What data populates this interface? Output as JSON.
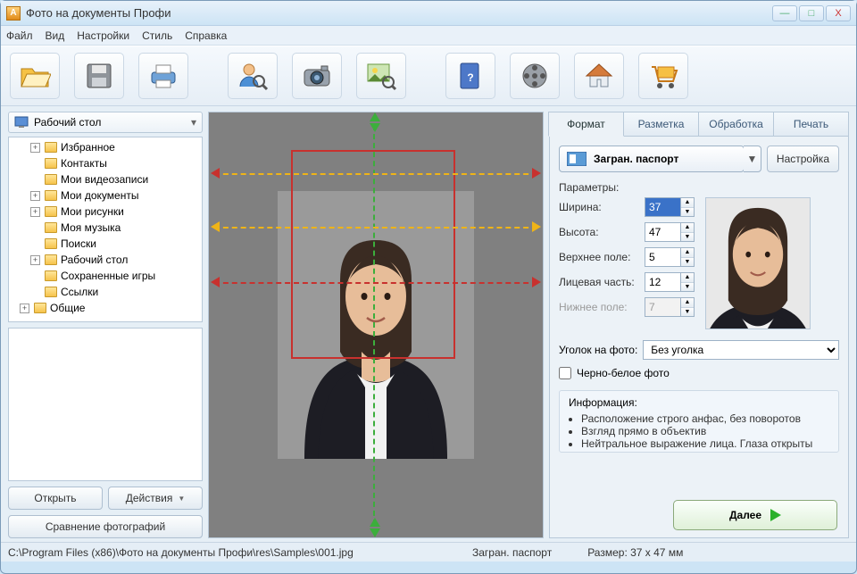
{
  "window": {
    "title": "Фото на документы Профи",
    "min": "—",
    "max": "□",
    "close": "X"
  },
  "menu": {
    "file": "Файл",
    "view": "Вид",
    "settings": "Настройки",
    "style": "Стиль",
    "help": "Справка"
  },
  "toolbar_icons": [
    "open",
    "save",
    "print",
    "user-search",
    "camera",
    "picture-search",
    "help-book",
    "film",
    "home",
    "cart"
  ],
  "left": {
    "path_label": "Рабочий стол",
    "tree": [
      {
        "exp": "+",
        "label": "Избранное"
      },
      {
        "exp": "",
        "label": "Контакты"
      },
      {
        "exp": "",
        "label": "Мои видеозаписи"
      },
      {
        "exp": "+",
        "label": "Мои документы"
      },
      {
        "exp": "+",
        "label": "Мои рисунки"
      },
      {
        "exp": "",
        "label": "Моя музыка"
      },
      {
        "exp": "",
        "label": "Поиски"
      },
      {
        "exp": "+",
        "label": "Рабочий стол"
      },
      {
        "exp": "",
        "label": "Сохраненные игры"
      },
      {
        "exp": "",
        "label": "Ссылки"
      },
      {
        "exp": "+",
        "label": "Общие"
      }
    ],
    "open_btn": "Открыть",
    "actions_btn": "Действия",
    "compare_btn": "Сравнение фотографий"
  },
  "tabs": {
    "format": "Формат",
    "layout": "Разметка",
    "process": "Обработка",
    "print": "Печать"
  },
  "format": {
    "type_label": "Загран. паспорт",
    "settings_btn": "Настройка",
    "params_label": "Параметры:",
    "width_label": "Ширина:",
    "height_label": "Высота:",
    "top_label": "Верхнее поле:",
    "face_label": "Лицевая часть:",
    "bottom_label": "Нижнее поле:",
    "width_val": "37",
    "height_val": "47",
    "top_val": "5",
    "face_val": "12",
    "bottom_val": "7",
    "corner_label": "Уголок на фото:",
    "corner_value": "Без уголка",
    "bw_label": "Черно-белое фото",
    "info_title": "Информация:",
    "info_items": [
      "Расположение строго анфас, без поворотов",
      "Взгляд прямо в объектив",
      "Нейтральное выражение лица. Глаза открыты"
    ],
    "next_btn": "Далее"
  },
  "status": {
    "path": "C:\\Program Files (x86)\\Фото на документы Профи\\res\\Samples\\001.jpg",
    "type": "Загран. паспорт",
    "size": "Размер: 37 x 47 мм"
  }
}
